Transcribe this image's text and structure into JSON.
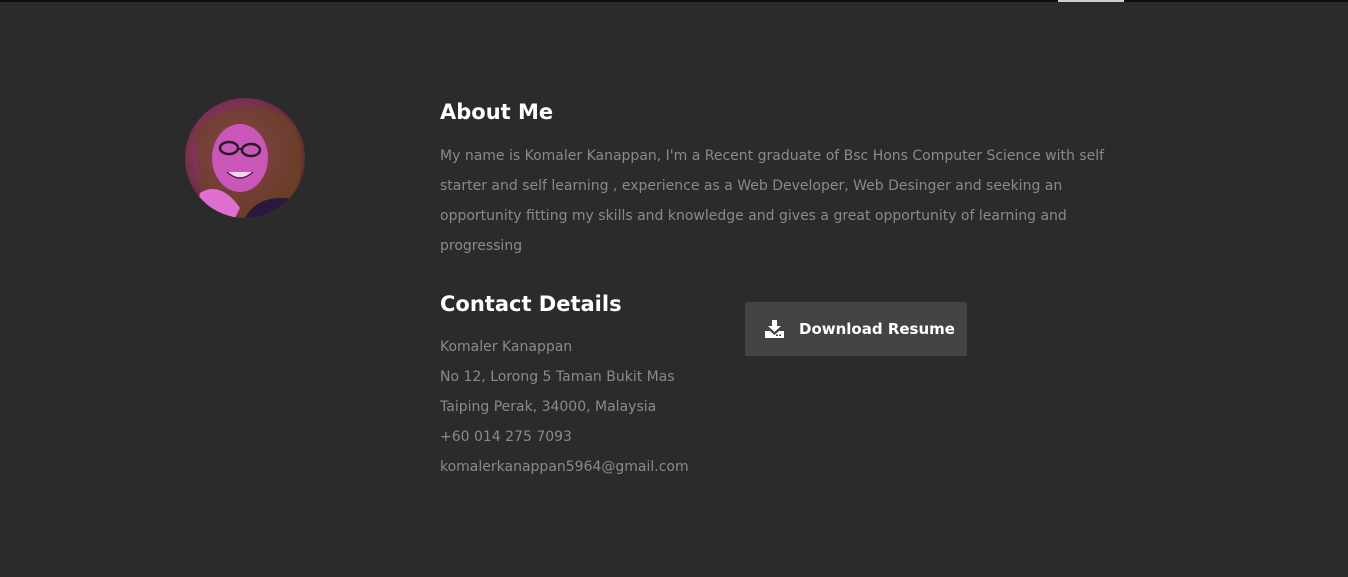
{
  "about": {
    "heading": "About Me",
    "text": "My name is Komaler Kanappan, I'm a Recent graduate of Bsc Hons Computer Science with self starter and self learning , experience as a Web Developer, Web Desinger and seeking an opportunity fitting my skills and knowledge and gives a great opportunity of learning and progressing"
  },
  "contact": {
    "heading": "Contact Details",
    "name": "Komaler Kanappan",
    "address_line1": "No 12, Lorong 5 Taman Bukit Mas",
    "address_line2": "Taiping Perak, 34000, Malaysia",
    "phone": "+60 014 275 7093",
    "email": "komalerkanappan5964@gmail.com"
  },
  "download": {
    "label": "Download Resume",
    "icon": "download-icon"
  },
  "avatar": {
    "icon": "profile-photo"
  },
  "colors": {
    "background": "#2b2b2b",
    "heading": "#ffffff",
    "body_text": "#8a8a8a",
    "button_bg": "#444444"
  }
}
